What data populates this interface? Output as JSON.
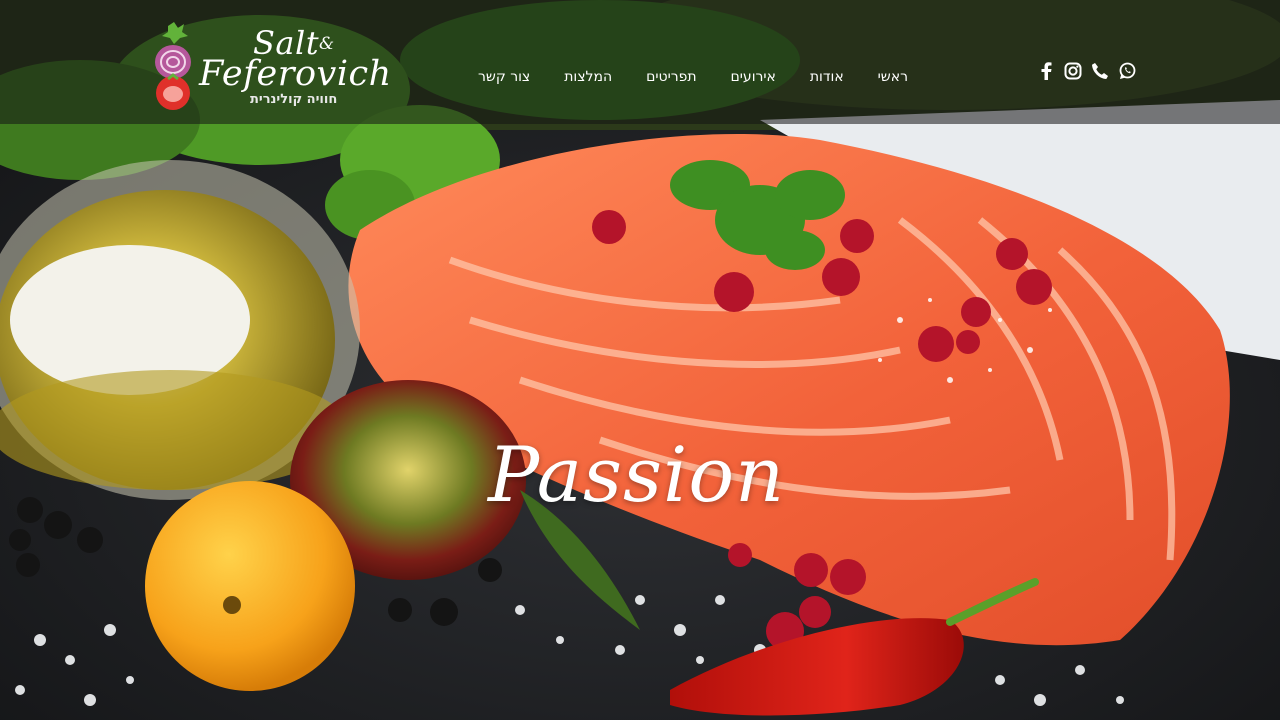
{
  "brand": {
    "name_line1": "Salt",
    "ampersand": "&",
    "name_line2": "Feferovich",
    "tagline": "חוויה קולינרית"
  },
  "nav": {
    "items": [
      {
        "label": "ראשי"
      },
      {
        "label": "אודות"
      },
      {
        "label": "אירועים"
      },
      {
        "label": "תפריטים"
      },
      {
        "label": "המלצות"
      },
      {
        "label": "צור קשר"
      }
    ]
  },
  "social": {
    "icons": [
      "facebook-icon",
      "instagram-icon",
      "phone-icon",
      "whatsapp-icon"
    ]
  },
  "hero": {
    "headline": "Passion"
  },
  "colors": {
    "header_overlay": "#141414",
    "salmon": "#f26a3c",
    "slate": "#1d1e20",
    "text": "#ffffff"
  }
}
